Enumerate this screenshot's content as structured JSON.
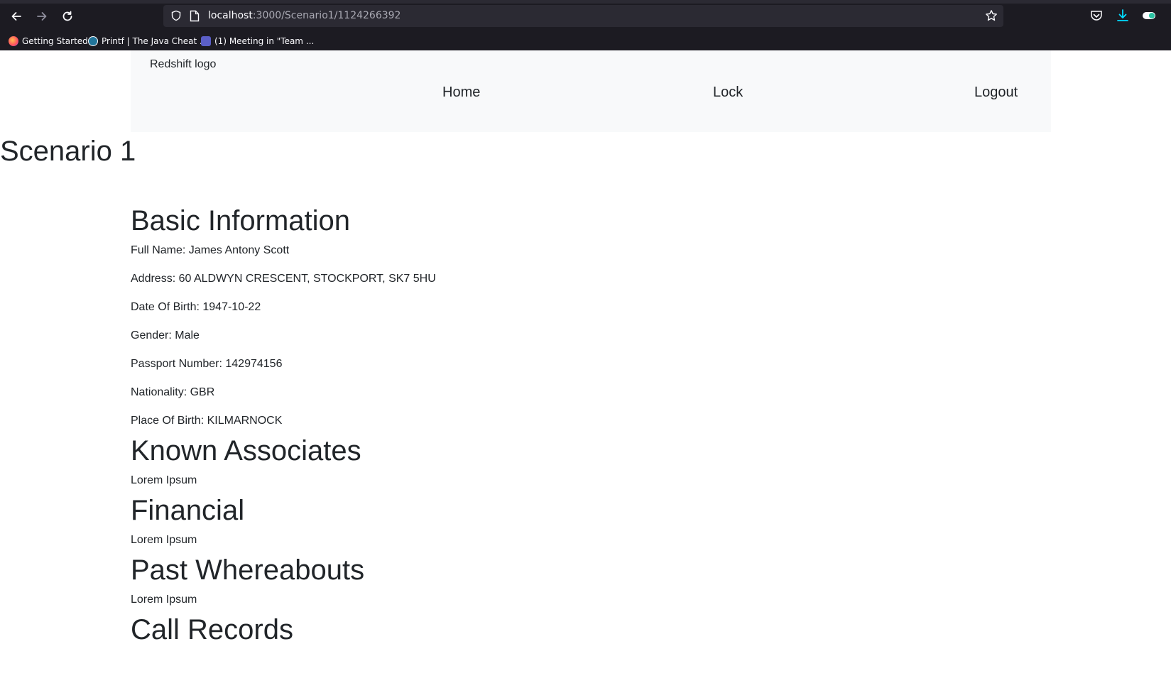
{
  "browser": {
    "url_host": "localhost",
    "url_path": ":3000/Scenario1/1124266392",
    "bookmarks": [
      {
        "label": "Getting Started",
        "icon": "firefox-icon"
      },
      {
        "label": "Printf | The Java Cheat ...",
        "icon": "wordpress-icon"
      },
      {
        "label": "(1) Meeting in \"Team ...",
        "icon": "teams-icon"
      }
    ]
  },
  "navbar": {
    "brand": "Redshift logo",
    "links": [
      "Home",
      "Lock",
      "Logout"
    ]
  },
  "page_title": "Scenario 1",
  "basic_information": {
    "title": "Basic Information",
    "fields": [
      "Full Name: James Antony Scott",
      "Address: 60 ALDWYN CRESCENT, STOCKPORT, SK7 5HU",
      "Date Of Birth: 1947-10-22",
      "Gender: Male",
      "Passport Number: 142974156",
      "Nationality: GBR",
      "Place Of Birth: KILMARNOCK"
    ]
  },
  "known_associates": {
    "title": "Known Associates",
    "text": "Lorem Ipsum"
  },
  "financial": {
    "title": "Financial",
    "text": "Lorem Ipsum"
  },
  "past_whereabouts": {
    "title": "Past Whereabouts",
    "text": "Lorem Ipsum"
  },
  "call_records": {
    "title": "Call Records"
  }
}
